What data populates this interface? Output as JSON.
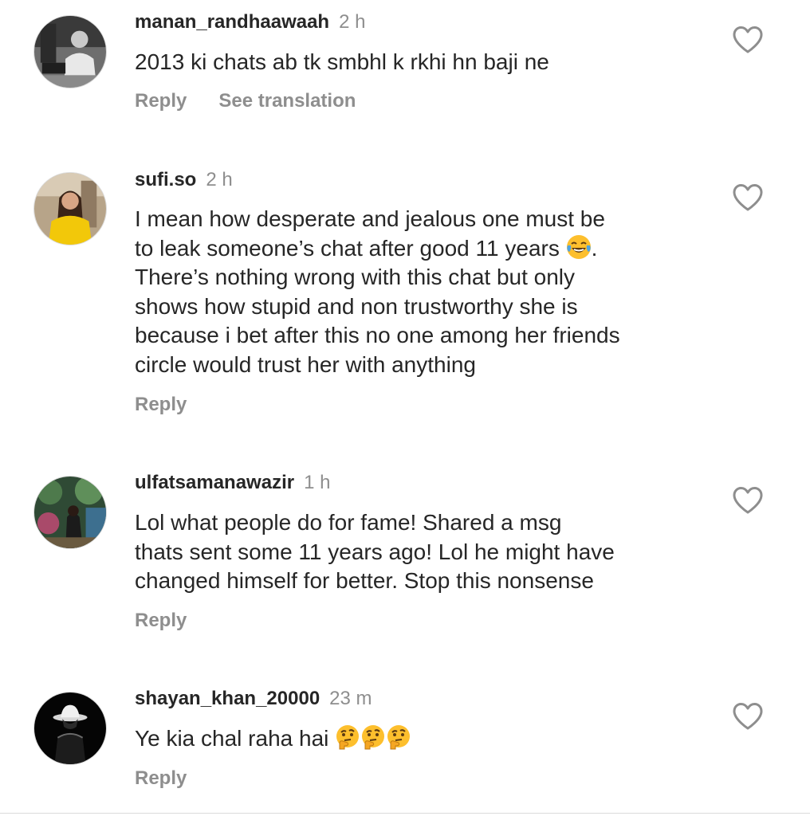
{
  "comments": [
    {
      "username": "manan_randhaawaah",
      "time": "2 h",
      "text": [
        "2013 ki chats ab tk smbhl k rkhi hn baji ne"
      ],
      "reply_label": "Reply",
      "translation_label": "See translation",
      "avatar_icon": "avatar-photo",
      "like_icon": "heart-outline-icon"
    },
    {
      "username": "sufi.so",
      "time": "2 h",
      "text": [
        "I mean how desperate and jealous one must be",
        "to leak someone’s chat after good 11 years",
        "There’s nothing wrong with this chat but only",
        "shows how stupid and non trustworthy she is",
        "because i bet after this no one among her friends",
        "circle would trust her with anything"
      ],
      "line2_suffix": ".",
      "reply_label": "Reply",
      "avatar_icon": "avatar-photo",
      "like_icon": "heart-outline-icon",
      "emoji": "face-with-tears-of-joy"
    },
    {
      "username": "ulfatsamanawazir",
      "time": "1 h",
      "text": [
        "Lol what people do for fame! Shared a msg",
        "thats sent some 11 years ago! Lol he might have",
        "changed himself for better. Stop this nonsense"
      ],
      "reply_label": "Reply",
      "avatar_icon": "avatar-photo",
      "like_icon": "heart-outline-icon"
    },
    {
      "username": "shayan_khan_20000",
      "time": "23 m",
      "text": [
        "Ye kia chal raha hai"
      ],
      "reply_label": "Reply",
      "avatar_icon": "avatar-photo",
      "like_icon": "heart-outline-icon",
      "emoji": "thinking-face"
    }
  ],
  "colors": {
    "text_primary": "#262626",
    "text_secondary": "#8e8e8e",
    "emoji_yellow": "#fdbf2d"
  }
}
